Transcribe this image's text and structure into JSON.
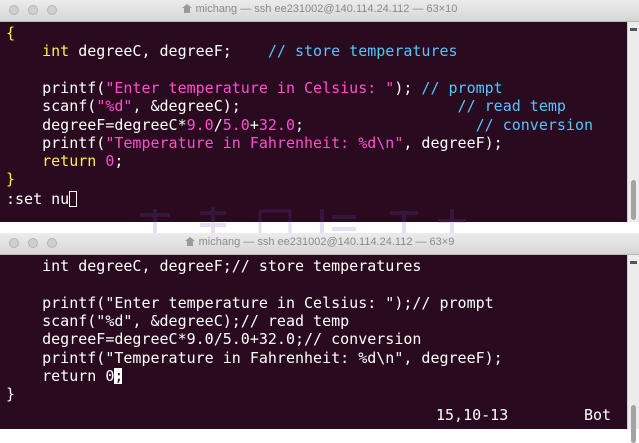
{
  "windows": [
    {
      "title": "michang — ssh ee231002@140.114.24.112 — 63×10",
      "lines": [
        [
          {
            "t": "{",
            "c": "c-br"
          }
        ],
        [
          {
            "t": "    ",
            "c": "c-plain"
          },
          {
            "t": "int",
            "c": "c-typ"
          },
          {
            "t": " degreeC, degreeF;    ",
            "c": "c-plain"
          },
          {
            "t": "// store temperatures",
            "c": "c-cmt"
          }
        ],
        [
          {
            "t": "",
            "c": "c-plain"
          }
        ],
        [
          {
            "t": "    printf(",
            "c": "c-plain"
          },
          {
            "t": "\"Enter temperature in Celsius: \"",
            "c": "c-str"
          },
          {
            "t": "); ",
            "c": "c-plain"
          },
          {
            "t": "// prompt",
            "c": "c-cmt"
          }
        ],
        [
          {
            "t": "    scanf(",
            "c": "c-plain"
          },
          {
            "t": "\"%d\"",
            "c": "c-str"
          },
          {
            "t": ", &degreeC);                        ",
            "c": "c-plain"
          },
          {
            "t": "// read temp",
            "c": "c-cmt"
          }
        ],
        [
          {
            "t": "    degreeF=degreeC*",
            "c": "c-plain"
          },
          {
            "t": "9.0",
            "c": "c-num"
          },
          {
            "t": "/",
            "c": "c-plain"
          },
          {
            "t": "5.0",
            "c": "c-num"
          },
          {
            "t": "+",
            "c": "c-plain"
          },
          {
            "t": "32.0",
            "c": "c-num"
          },
          {
            "t": ";                   ",
            "c": "c-plain"
          },
          {
            "t": "// conversion",
            "c": "c-cmt"
          }
        ],
        [
          {
            "t": "    printf(",
            "c": "c-plain"
          },
          {
            "t": "\"Temperature in Fahrenheit: %d\\n\"",
            "c": "c-str"
          },
          {
            "t": ", degreeF);",
            "c": "c-plain"
          }
        ],
        [
          {
            "t": "    ",
            "c": "c-plain"
          },
          {
            "t": "return",
            "c": "c-kw"
          },
          {
            "t": " ",
            "c": "c-plain"
          },
          {
            "t": "0",
            "c": "c-num"
          },
          {
            "t": ";",
            "c": "c-plain"
          }
        ],
        [
          {
            "t": "}",
            "c": "c-br"
          }
        ]
      ],
      "command_line": ":set nu"
    },
    {
      "title": "michang — ssh ee231002@140.114.24.112 — 63×9",
      "lines": [
        [
          {
            "t": "    int degreeC, degreeF;// store temperatures",
            "c": "c-plain"
          }
        ],
        [
          {
            "t": "",
            "c": "c-plain"
          }
        ],
        [
          {
            "t": "    printf(\"Enter temperature in Celsius: \");// prompt",
            "c": "c-plain"
          }
        ],
        [
          {
            "t": "    scanf(\"%d\", &degreeC);// read temp",
            "c": "c-plain"
          }
        ],
        [
          {
            "t": "    degreeF=degreeC*9.0/5.0+32.0;// conversion",
            "c": "c-plain"
          }
        ],
        [
          {
            "t": "    printf(\"Temperature in Fahrenheit: %d\\n\", degreeF);",
            "c": "c-plain"
          }
        ],
        [
          {
            "t": "    return 0",
            "c": "c-plain"
          }
        ],
        [
          {
            "t": "}",
            "c": "c-plain"
          }
        ]
      ],
      "cursor_line_suffix": ";",
      "status": {
        "position": "15,10-13",
        "scroll": "Bot"
      }
    }
  ],
  "icons": {
    "home": "home-icon",
    "scroll_marker": "scroll-marker-icon"
  }
}
